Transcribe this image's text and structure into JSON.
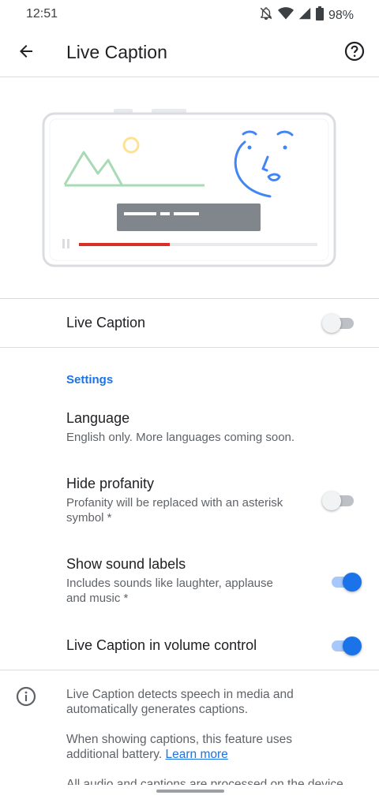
{
  "status_bar": {
    "time": "12:51",
    "battery": "98%",
    "icons": [
      "do-not-disturb-bell-off-icon",
      "wifi-icon",
      "cell-signal-icon",
      "battery-icon"
    ]
  },
  "app_bar": {
    "title": "Live Caption",
    "back_icon": "arrow-back-icon",
    "help_icon": "help-circle-icon"
  },
  "main_toggle": {
    "label": "Live Caption",
    "enabled": false
  },
  "settings": {
    "header": "Settings",
    "language": {
      "title": "Language",
      "subtitle": "English only. More languages coming soon."
    },
    "hide_profanity": {
      "title": "Hide profanity",
      "subtitle_line1": "Profanity will be replaced with an asterisk",
      "subtitle_line2": "symbol *",
      "enabled": false
    },
    "sound_labels": {
      "title": "Show sound labels",
      "subtitle_line1": "Includes sounds like laughter, applause",
      "subtitle_line2": "and music *",
      "enabled": true
    },
    "volume_control": {
      "title": "Live Caption in volume control",
      "enabled": true
    }
  },
  "info": {
    "icon": "info-outline-icon",
    "para1_line1": "Live Caption detects speech in media and",
    "para1_line2": "automatically generates captions.",
    "para2_line1": "When showing captions, this feature uses",
    "para2_line2_prefix": "additional battery. ",
    "learn_more": "Learn more",
    "para3_partial": "All audio and captions are processed on the device"
  },
  "illustration": {
    "video_progress": 0.38
  },
  "colors": {
    "accent": "#1a73e8",
    "progress_red": "#d93025",
    "mountain_green": "#a8dab5",
    "sun_yellow": "#fde293",
    "caption_bar_grey": "#80868b"
  }
}
